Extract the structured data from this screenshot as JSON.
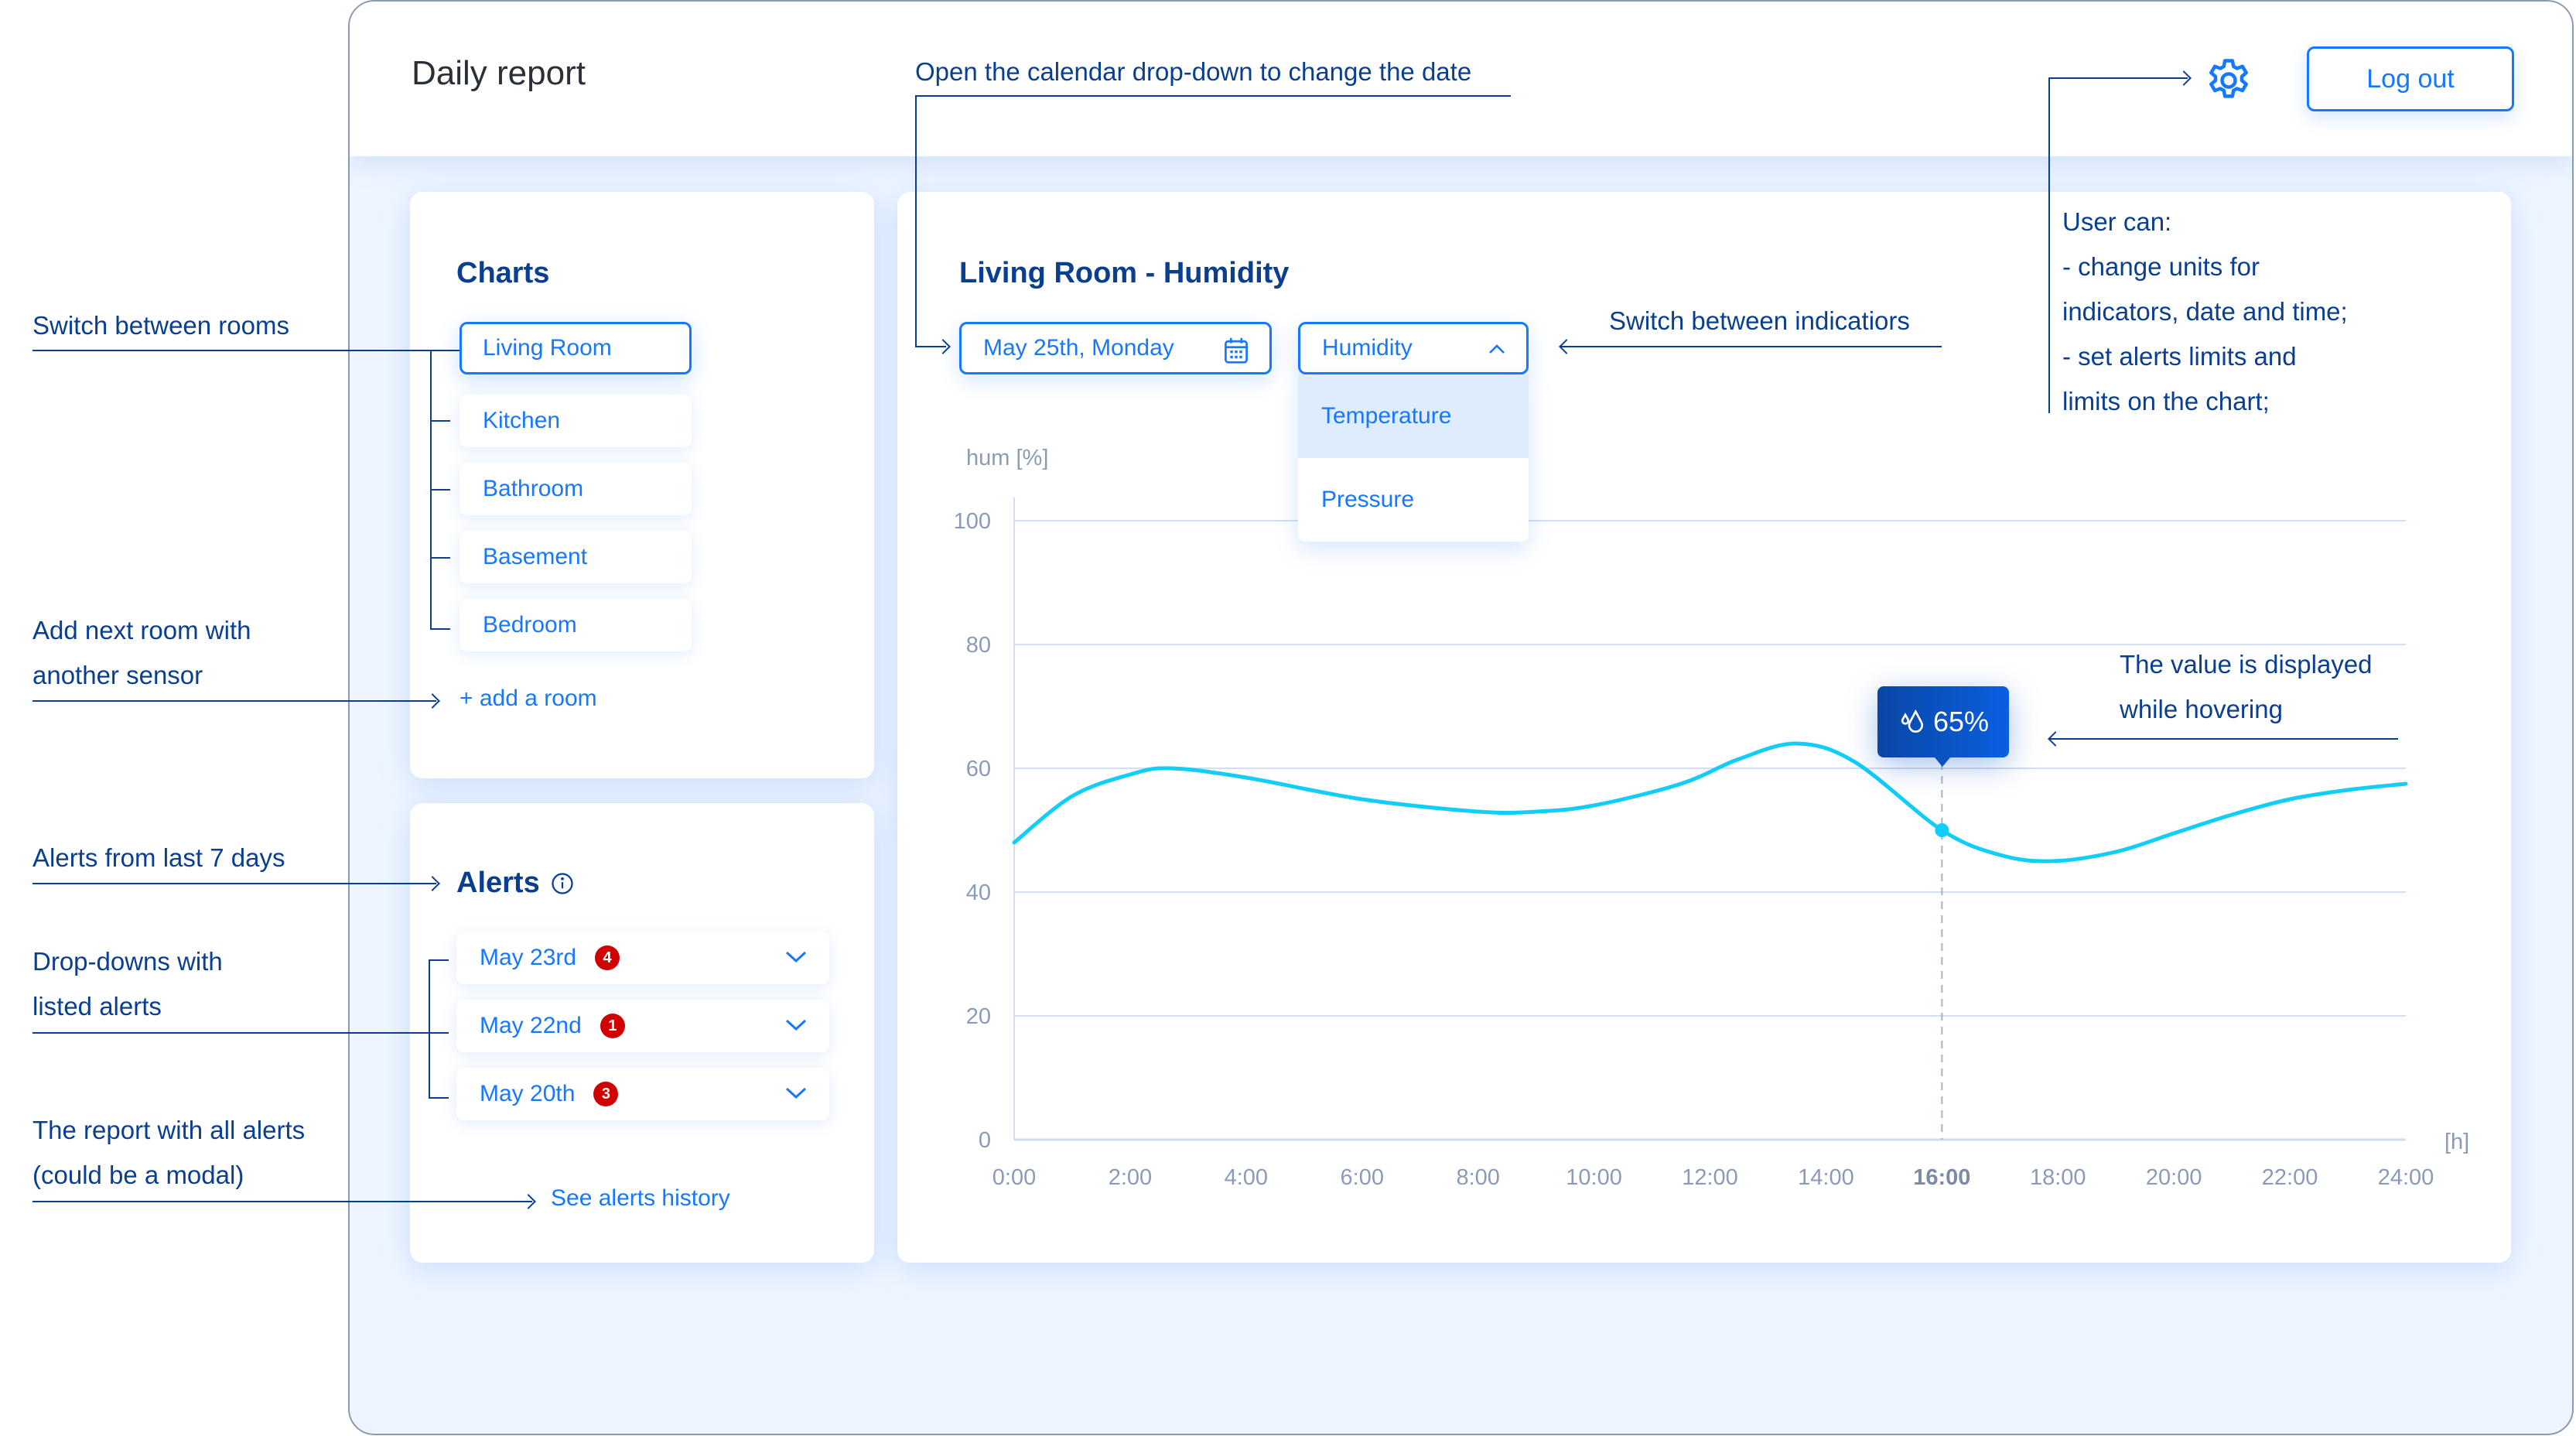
{
  "header": {
    "title": "Daily report",
    "settings_icon": "gear-icon",
    "logout_label": "Log out"
  },
  "charts_panel": {
    "title": "Charts",
    "rooms": [
      {
        "label": "Living Room",
        "active": true
      },
      {
        "label": "Kitchen",
        "active": false
      },
      {
        "label": "Bathroom",
        "active": false
      },
      {
        "label": "Basement",
        "active": false
      },
      {
        "label": "Bedroom",
        "active": false
      }
    ],
    "add_room_label": "+ add a room"
  },
  "alerts_panel": {
    "title": "Alerts",
    "info_icon": "info-icon",
    "items": [
      {
        "date": "May 23rd",
        "count": "4"
      },
      {
        "date": "May 22nd",
        "count": "1"
      },
      {
        "date": "May 20th",
        "count": "3"
      }
    ],
    "history_link": "See alerts history"
  },
  "chart_panel": {
    "title": "Living Room - Humidity",
    "date_value": "May 25th, Monday",
    "date_icon": "calendar-icon",
    "indicator_value": "Humidity",
    "indicator_options": [
      "Temperature",
      "Pressure"
    ],
    "hovered_option": "Temperature",
    "tooltip_value": "65%",
    "tooltip_icon": "droplets-icon"
  },
  "chart_data": {
    "type": "line",
    "title": "Living Room - Humidity",
    "xlabel": "[h]",
    "ylabel": "hum [%]",
    "x_ticks": [
      "0:00",
      "2:00",
      "4:00",
      "6:00",
      "8:00",
      "10:00",
      "12:00",
      "14:00",
      "16:00",
      "18:00",
      "20:00",
      "22:00",
      "24:00"
    ],
    "highlighted_x_tick": "16:00",
    "y_ticks": [
      "0",
      "20",
      "40",
      "60",
      "80",
      "100"
    ],
    "ylim": [
      0,
      100
    ],
    "xlim": [
      0,
      24
    ],
    "grid": true,
    "series": [
      {
        "name": "Humidity",
        "color": "#12cdf7",
        "x": [
          0,
          1,
          2,
          2.7,
          4,
          6,
          8,
          9,
          10,
          11.5,
          12.5,
          13.5,
          14.5,
          16,
          17,
          17.9,
          19,
          20,
          21,
          22,
          23,
          24
        ],
        "y": [
          48,
          55.5,
          59,
          60,
          58.5,
          55,
          53,
          53,
          54,
          57.5,
          61.5,
          64,
          61,
          50,
          46,
          45,
          46.5,
          49.5,
          52.5,
          55,
          56.5,
          57.5
        ]
      }
    ],
    "hover": {
      "x": 16,
      "label": "65%"
    }
  },
  "annotations": {
    "rooms": "Switch between rooms",
    "add_room": [
      "Add next room with",
      "another sensor"
    ],
    "alerts_period": "Alerts from last 7 days",
    "alert_dropdowns": [
      "Drop-downs with",
      "listed alerts"
    ],
    "alerts_report": [
      "The report with all alerts",
      "(could be a modal)"
    ],
    "calendar": "Open the calendar drop-down to change the date",
    "indicators": "Switch between indicatiors",
    "settings": [
      "User can:",
      "- change units for",
      "indicators, date and time;",
      "- set alerts limits and",
      "limits on the chart;"
    ],
    "hover": [
      "The value is displayed",
      "while hovering"
    ]
  },
  "colors": {
    "accent": "#1677ff",
    "heading": "#0a3f8f",
    "annotation": "#0a3f8f",
    "badge": "#d10000",
    "line": "#12cdf7",
    "background": "#eef5ff"
  }
}
